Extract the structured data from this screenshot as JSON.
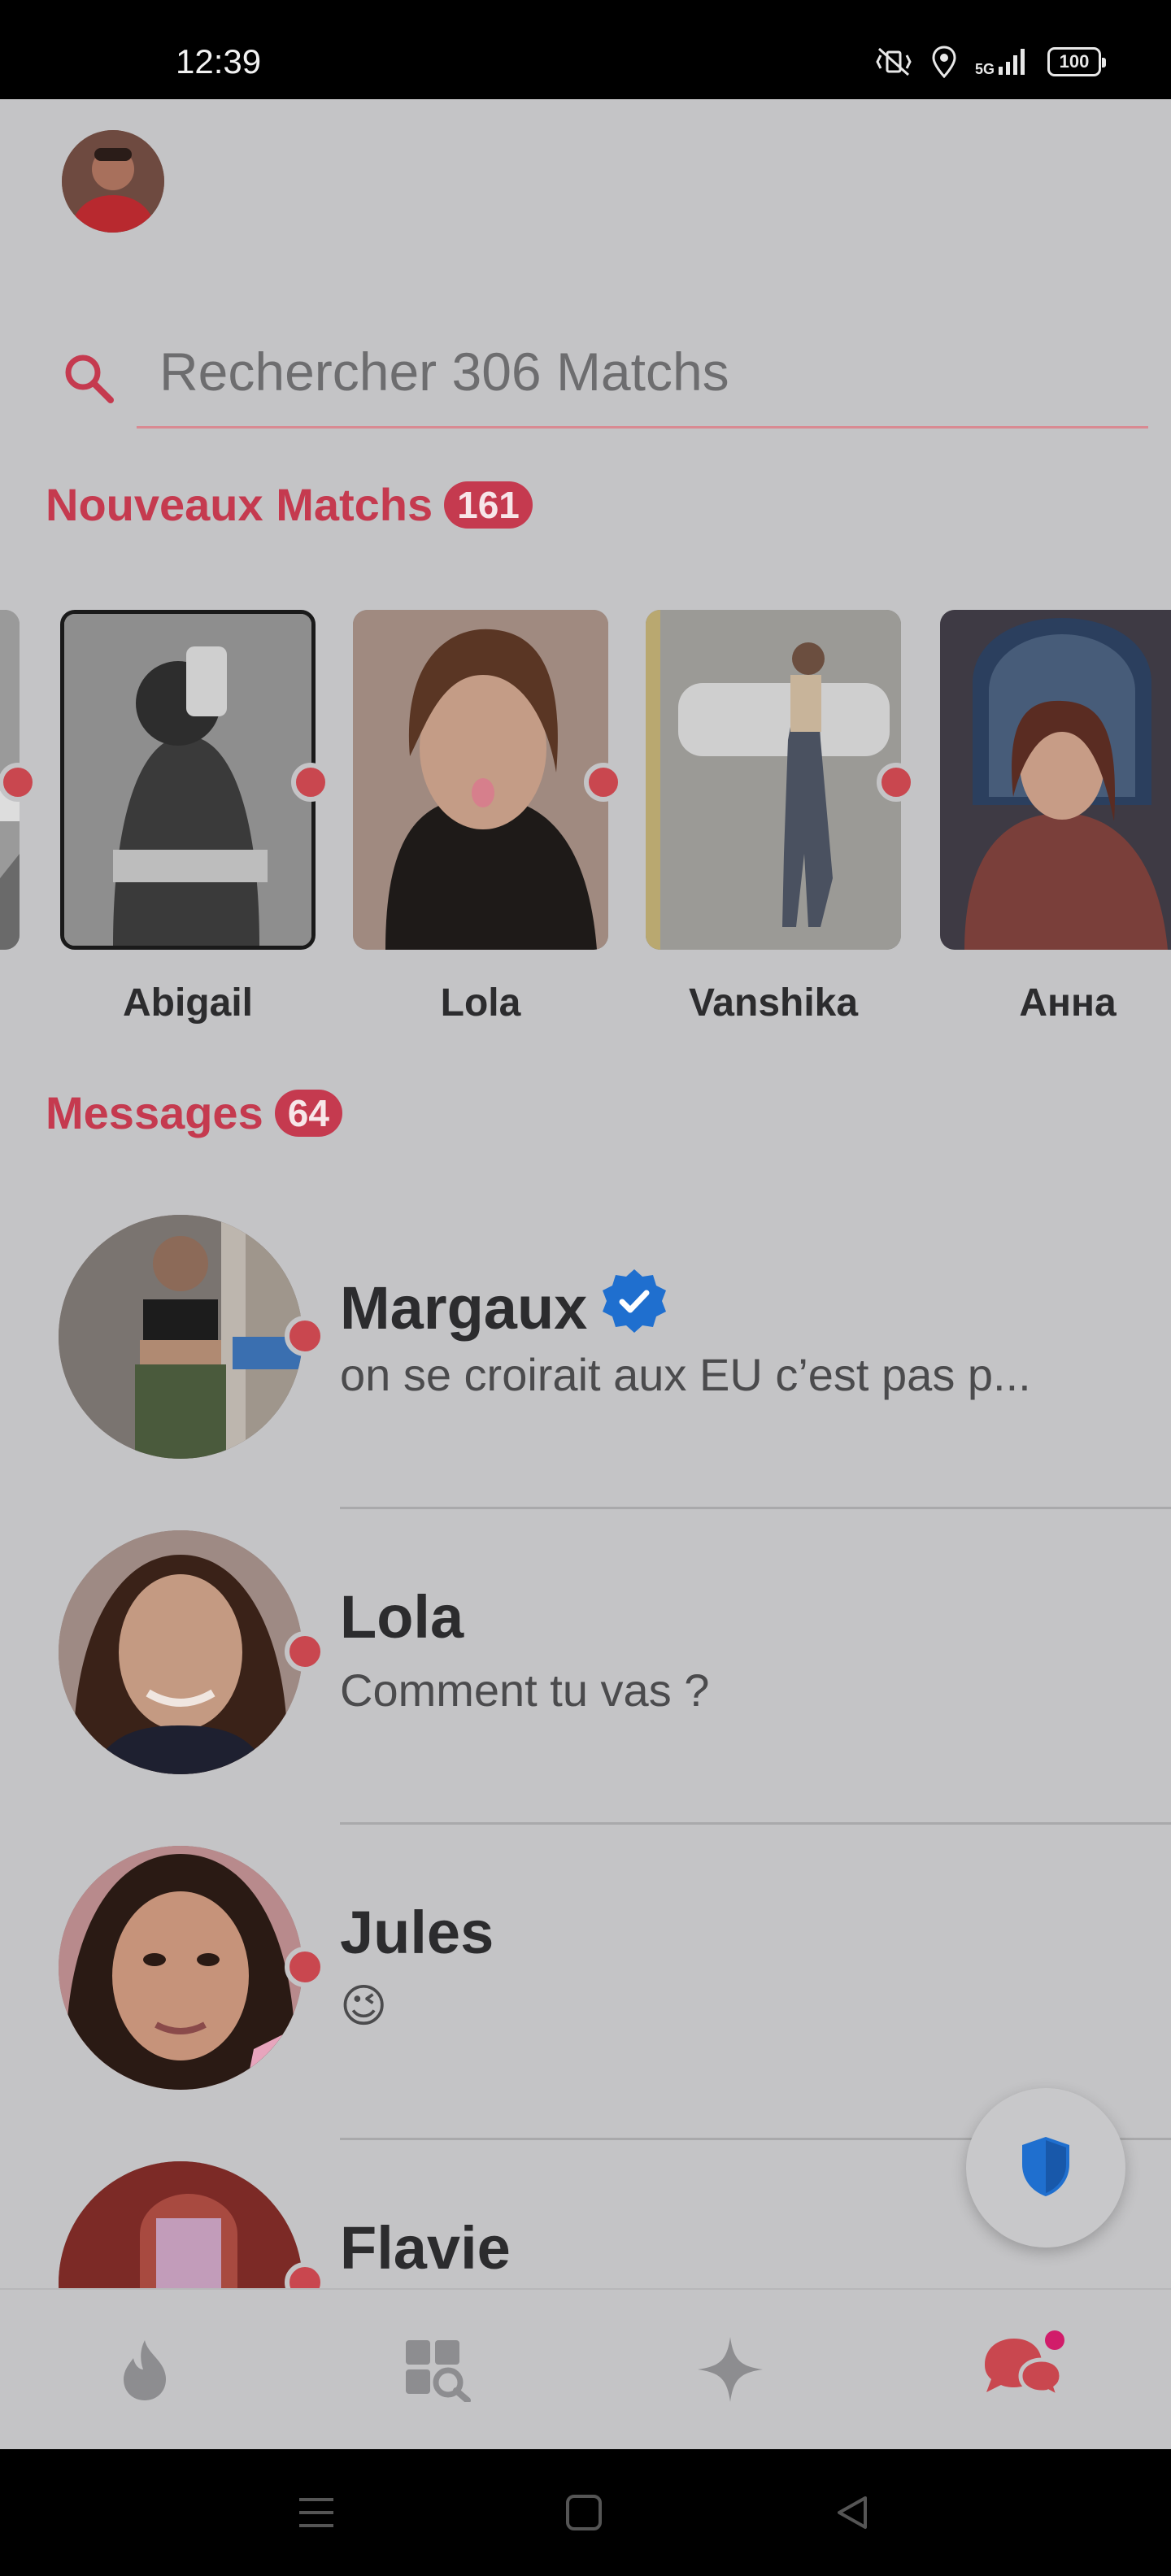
{
  "status_bar": {
    "time": "12:39",
    "network": "5G",
    "battery": "100"
  },
  "search": {
    "placeholder": "Rechercher 306 Matchs"
  },
  "new_matches": {
    "title": "Nouveaux Matchs",
    "count": "161",
    "items": [
      {
        "name": ""
      },
      {
        "name": "Abigail"
      },
      {
        "name": "Lola"
      },
      {
        "name": "Vanshika"
      },
      {
        "name": "Анна"
      }
    ]
  },
  "messages": {
    "title": "Messages",
    "count": "64",
    "items": [
      {
        "name": "Margaux",
        "preview": "on se croirait aux EU c’est pas p...",
        "verified": true
      },
      {
        "name": "Lola",
        "preview": "Comment tu vas ?",
        "verified": false
      },
      {
        "name": "Jules",
        "preview": "😉",
        "verified": false
      },
      {
        "name": "Flavie",
        "preview": "",
        "verified": false
      }
    ]
  },
  "bottom_nav": {
    "items": [
      {
        "icon": "flame-icon"
      },
      {
        "icon": "explore-grid-icon"
      },
      {
        "icon": "sparkle-icon"
      },
      {
        "icon": "chat-bubbles-icon"
      }
    ]
  },
  "colors": {
    "accent": "#c53a4f",
    "dot": "#c9474f",
    "verified": "#1f6fcf",
    "background": "#c4c4c6"
  }
}
